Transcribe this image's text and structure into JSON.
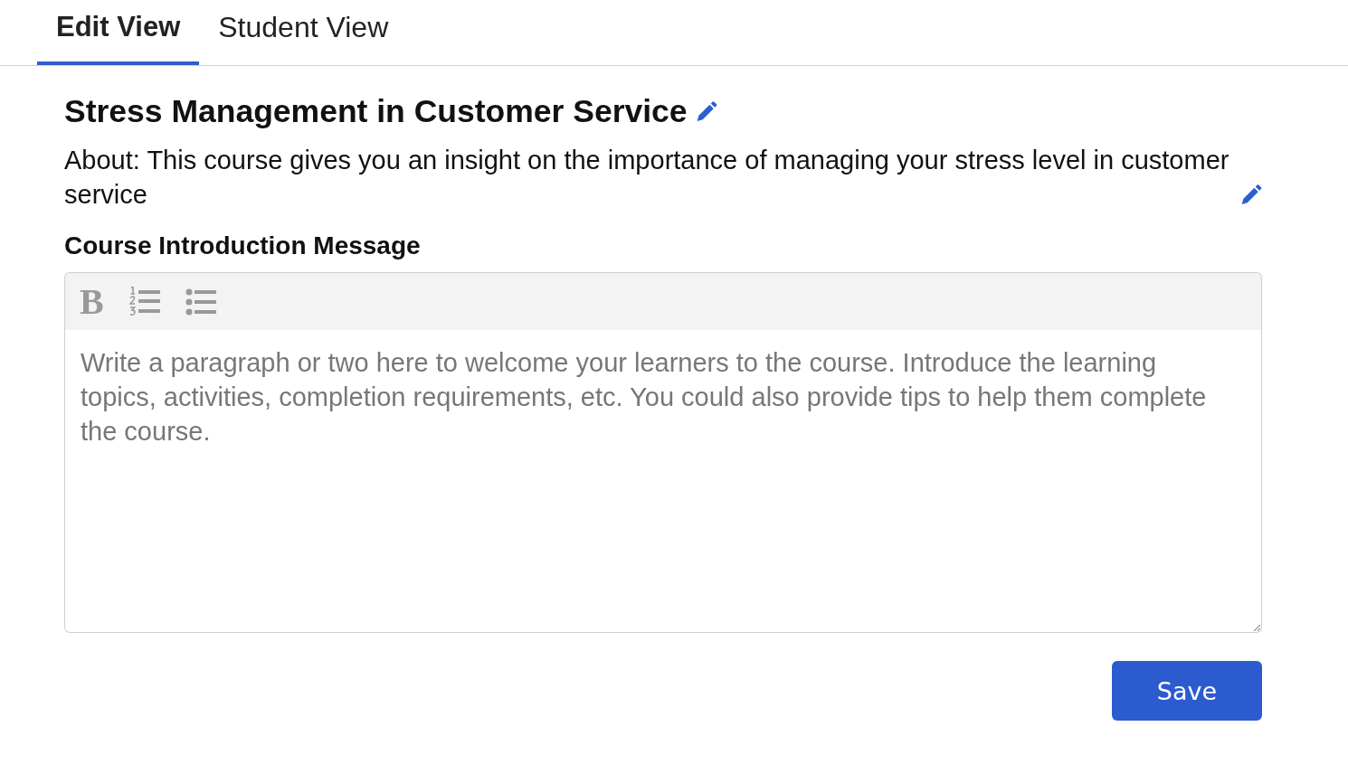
{
  "tabs": [
    {
      "label": "Edit View",
      "selected": true
    },
    {
      "label": "Student View",
      "selected": false
    }
  ],
  "course": {
    "title": "Stress Management in Customer Service",
    "about": "About: This course gives you an insight on the importance of managing your stress level in customer service"
  },
  "intro": {
    "heading": "Course Introduction Message",
    "toolbar": [
      {
        "kind": "bold",
        "label": "B"
      },
      {
        "kind": "numbered-list"
      },
      {
        "kind": "bulleted-list"
      }
    ],
    "placeholder": "Write a paragraph or two here to welcome your learners to the course. Introduce the learning topics, activities, completion requirements, etc. You could also provide tips to help them complete the course."
  },
  "save_button": "Save"
}
